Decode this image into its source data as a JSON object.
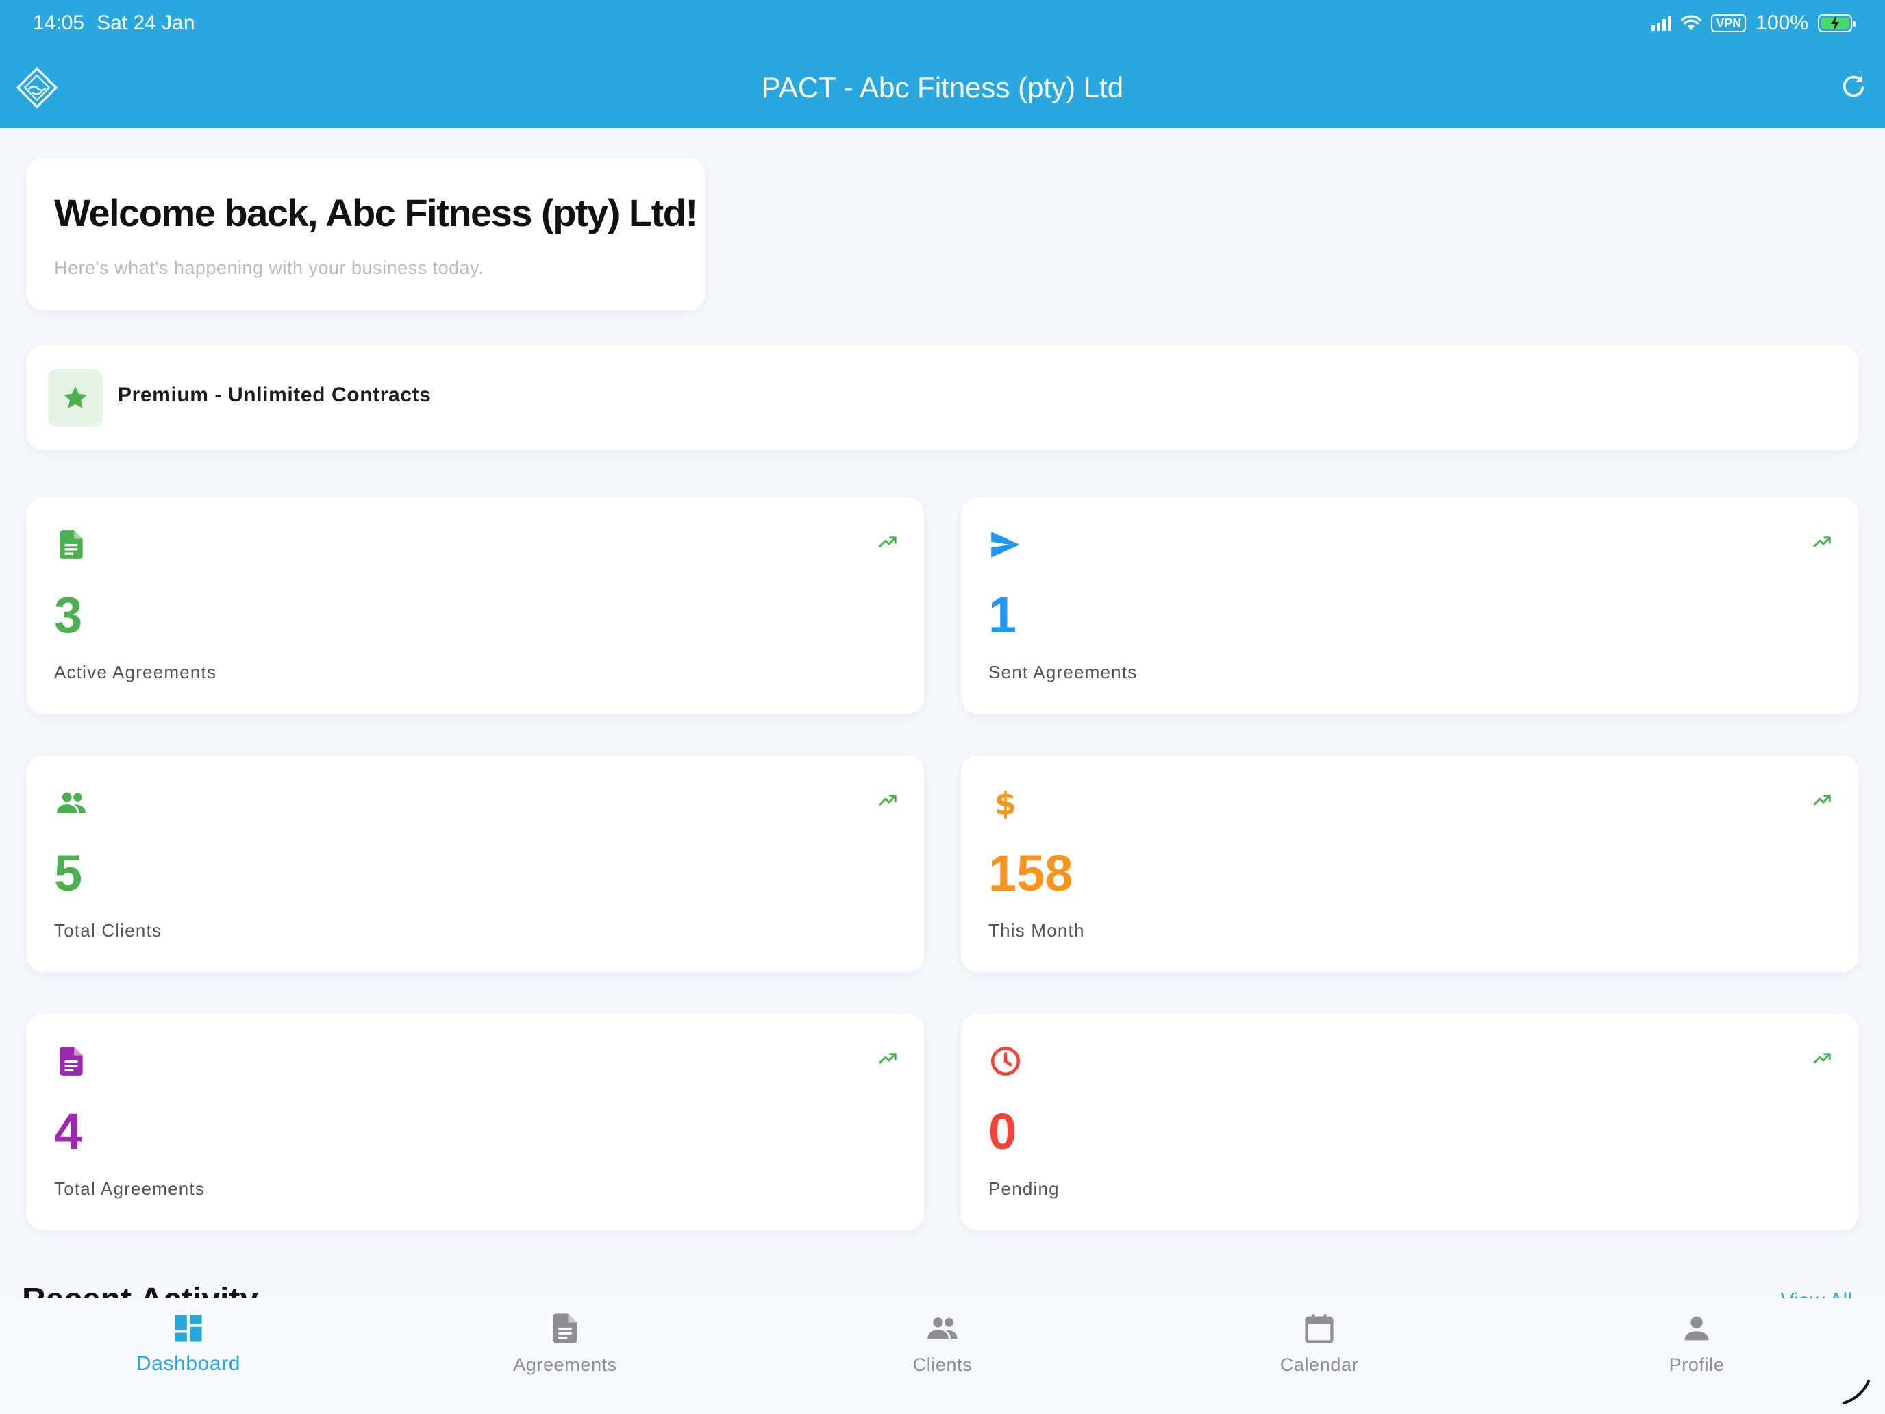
{
  "status_bar": {
    "time": "14:05",
    "date": "Sat 24 Jan",
    "vpn": "VPN",
    "battery": "100%",
    "battery_level": 1.0
  },
  "nav": {
    "title": "PACT - Abc Fitness (pty) Ltd",
    "logo_icon": "handshake-diamond-icon",
    "refresh_icon": "refresh-icon"
  },
  "welcome": {
    "title": "Welcome back, Abc Fitness (pty) Ltd!",
    "subtitle": "Here's what's happening with your business today."
  },
  "plan": {
    "label": "Premium - Unlimited Contracts",
    "icon": "star-icon",
    "color": "#4caf50"
  },
  "stats": [
    {
      "value": "3",
      "label": "Active Agreements",
      "icon": "document-icon",
      "color": "#4caf50"
    },
    {
      "value": "1",
      "label": "Sent Agreements",
      "icon": "send-icon",
      "color": "#2196f3"
    },
    {
      "value": "5",
      "label": "Total Clients",
      "icon": "people-icon",
      "color": "#4caf50"
    },
    {
      "value": "158",
      "label": "This Month",
      "icon": "dollar-icon",
      "color": "#f7941d"
    },
    {
      "value": "4",
      "label": "Total Agreements",
      "icon": "document-icon",
      "color": "#9c27b0"
    },
    {
      "value": "0",
      "label": "Pending",
      "icon": "clock-icon",
      "color": "#f44336"
    }
  ],
  "trend_color": "#4caf50",
  "recent_activity": {
    "title": "Recent Activity",
    "view_all": "View All"
  },
  "tabs": [
    {
      "label": "Dashboard",
      "icon": "dashboard-icon",
      "active": true
    },
    {
      "label": "Agreements",
      "icon": "document-icon",
      "active": false
    },
    {
      "label": "Clients",
      "icon": "people-icon",
      "active": false
    },
    {
      "label": "Calendar",
      "icon": "calendar-icon",
      "active": false
    },
    {
      "label": "Profile",
      "icon": "person-icon",
      "active": false
    }
  ],
  "colors": {
    "primary": "#29a8e0",
    "background": "#f4f8fc",
    "inactive_tab": "#8e8e93"
  }
}
